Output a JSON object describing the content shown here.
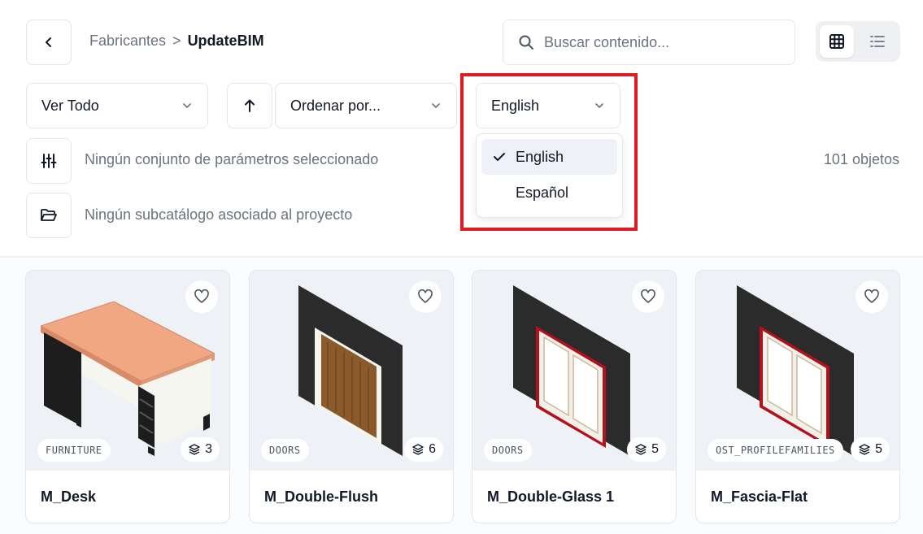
{
  "breadcrumb": {
    "parent": "Fabricantes",
    "separator": ">",
    "current": "UpdateBIM"
  },
  "search": {
    "placeholder": "Buscar contenido..."
  },
  "filters": {
    "view_all": "Ver Todo",
    "order_by": "Ordenar por...",
    "language_selected": "English",
    "language_options": [
      "English",
      "Español"
    ]
  },
  "parameters_text": "Ningún conjunto de parámetros seleccionado",
  "subcatalog_text": "Ningún subcatálogo asociado al proyecto",
  "object_count": "101 objetos",
  "colors": {
    "highlight": "#e11b23",
    "card_bg": "#eef1f6",
    "wall": "#2b2b2b",
    "frame_red": "#b3111b"
  },
  "cards": [
    {
      "name": "M_Desk",
      "category": "FURNITURE",
      "layers": "3",
      "icon": "desk"
    },
    {
      "name": "M_Double-Flush",
      "category": "DOORS",
      "layers": "6",
      "icon": "door-flush"
    },
    {
      "name": "M_Double-Glass 1",
      "category": "DOORS",
      "layers": "5",
      "icon": "door-glass"
    },
    {
      "name": "M_Fascia-Flat",
      "category": "OST_PROFILEFAMILIES",
      "layers": "5",
      "icon": "door-glass"
    }
  ]
}
